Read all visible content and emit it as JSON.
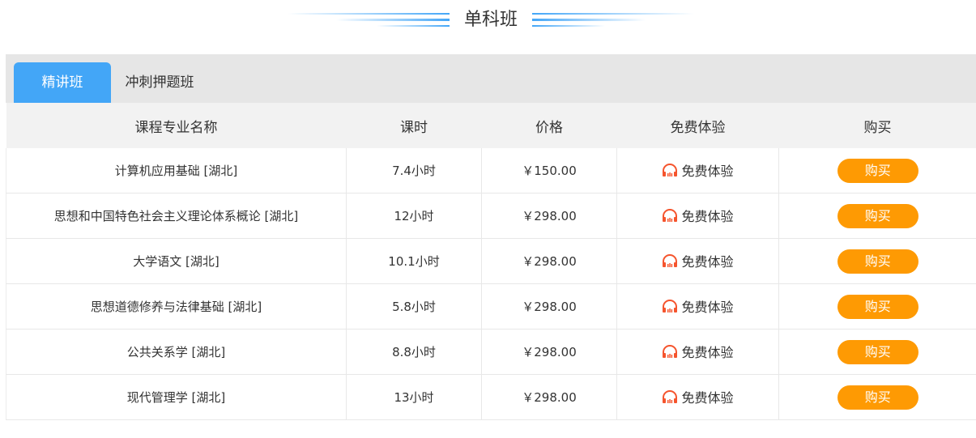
{
  "section": {
    "title": "单科班"
  },
  "tabs": [
    {
      "label": "精讲班",
      "active": true
    },
    {
      "label": "冲刺押题班",
      "active": false
    }
  ],
  "table": {
    "headers": {
      "name": "课程专业名称",
      "hours": "课时",
      "price": "价格",
      "trial": "免费体验",
      "buy": "购买"
    },
    "rows": [
      {
        "name": "计算机应用基础 [湖北]",
        "hours": "7.4小时",
        "price": "￥150.00",
        "trial": "免费体验",
        "buy": "购买"
      },
      {
        "name": "思想和中国特色社会主义理论体系概论 [湖北]",
        "hours": "12小时",
        "price": "￥298.00",
        "trial": "免费体验",
        "buy": "购买"
      },
      {
        "name": "大学语文 [湖北]",
        "hours": "10.1小时",
        "price": "￥298.00",
        "trial": "免费体验",
        "buy": "购买"
      },
      {
        "name": "思想道德修养与法律基础 [湖北]",
        "hours": "5.8小时",
        "price": "￥298.00",
        "trial": "免费体验",
        "buy": "购买"
      },
      {
        "name": "公共关系学 [湖北]",
        "hours": "8.8小时",
        "price": "￥298.00",
        "trial": "免费体验",
        "buy": "购买"
      },
      {
        "name": "现代管理学 [湖北]",
        "hours": "13小时",
        "price": "￥298.00",
        "trial": "免费体验",
        "buy": "购买"
      }
    ]
  },
  "colors": {
    "accent_blue": "#43a6f7",
    "price_red": "#f5542d",
    "buy_orange": "#fe9a03",
    "headphone_orange": "#f5542d"
  },
  "icons": {
    "trial": "headphone-icon"
  }
}
